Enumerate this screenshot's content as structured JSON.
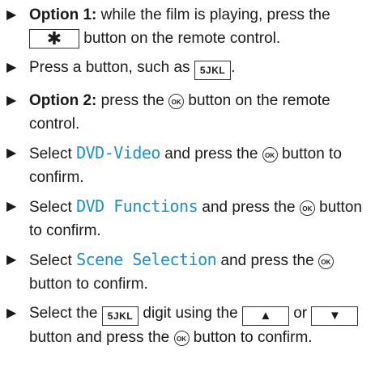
{
  "items": [
    {
      "bold": "Option 1:",
      "t1": " while the film is playing, press the ",
      "key": "✱",
      "t2": " button on the remote control."
    },
    {
      "t1": "Press a button, such as ",
      "key": "5JKL",
      "t2": "."
    },
    {
      "bold": "Option 2:",
      "t1": " press the ",
      "ok": "OK",
      "t2": " button on the remote control."
    },
    {
      "t1": "Select ",
      "mono": "DVD-Video",
      "t2": " and press the ",
      "ok": "OK",
      "t3": " button to confirm."
    },
    {
      "t1": "Select ",
      "mono": "DVD Functions",
      "t2": " and press the ",
      "ok": "OK",
      "t3": " button to confirm."
    },
    {
      "t1": "Select ",
      "mono": "Scene Selection",
      "t2": " and press the ",
      "ok": "OK",
      "t3": " button to confirm."
    },
    {
      "t1": "Select the ",
      "key": "5JKL",
      "t2": " digit using the ",
      "up": "▲",
      "t3": " or ",
      "down": "▼",
      "t4": " button and press the ",
      "ok": "OK",
      "t5": " button to confirm."
    }
  ],
  "icons": {
    "bullet": "arrow-right-icon",
    "ok": "ok-button-icon"
  }
}
